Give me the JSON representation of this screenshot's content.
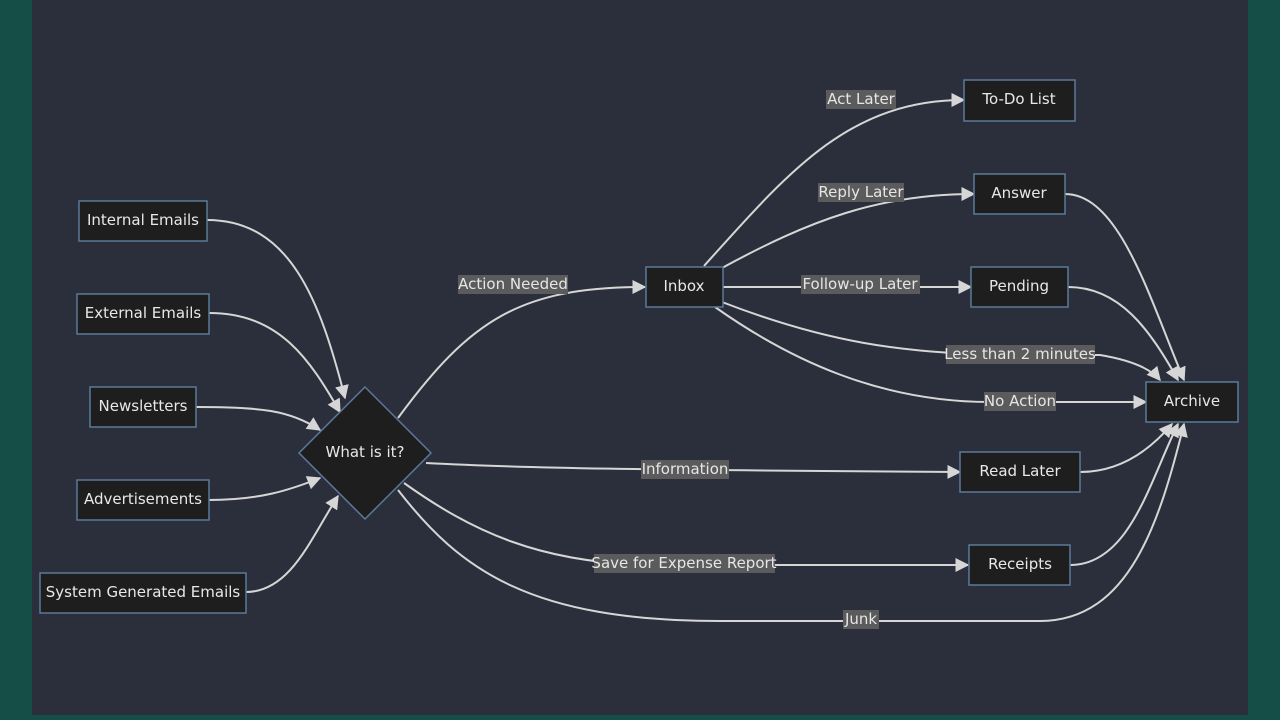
{
  "nodes": {
    "internal_emails": "Internal Emails",
    "external_emails": "External Emails",
    "newsletters": "Newsletters",
    "advertisements": "Advertisements",
    "system_generated_emails": "System Generated Emails",
    "what_is_it": "What is it?",
    "inbox": "Inbox",
    "todo_list": "To-Do List",
    "answer": "Answer",
    "pending": "Pending",
    "archive": "Archive",
    "read_later": "Read Later",
    "receipts": "Receipts"
  },
  "edges": {
    "action_needed": "Action Needed",
    "act_later": "Act Later",
    "reply_later": "Reply Later",
    "follow_up_later": "Follow-up Later",
    "less_than_2_minutes": "Less than 2 minutes",
    "no_action": "No Action",
    "information": "Information",
    "save_for_expense_report": "Save for Expense Report",
    "junk": "Junk"
  },
  "colors": {
    "frame": "#144e47",
    "canvas": "#2a2f3b",
    "node_fill": "#1e1e1e",
    "node_border": "#5a7a99",
    "edge": "#d6d6d6",
    "edge_label_bg": "#5b5b5b",
    "text": "#e8e8e8"
  }
}
